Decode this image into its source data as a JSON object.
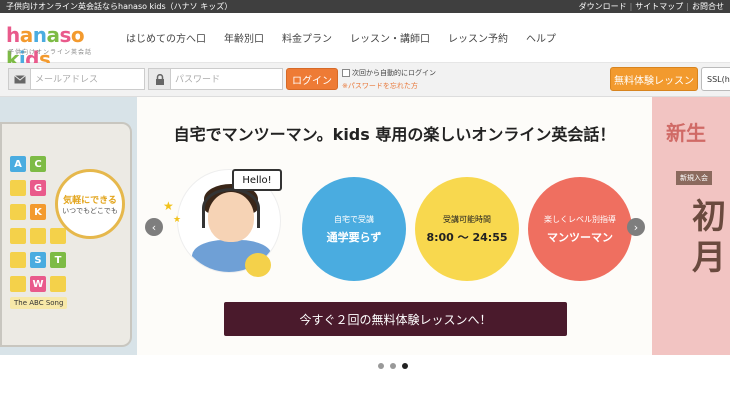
{
  "topbar": {
    "tagline": "子供向けオンライン英会話ならhanaso kids（ハナソ キッズ）",
    "links": [
      "ダウンロード",
      "サイトマップ",
      "お問合せ"
    ]
  },
  "logo": {
    "word": "hanaso kids",
    "sub": "子供向けオンライン英会話"
  },
  "nav": [
    "はじめての方へ口",
    "年齢別口",
    "料金プラン",
    "レッスン・講師口",
    "レッスン予約",
    "ヘルプ"
  ],
  "login": {
    "email_placeholder": "メールアドレス",
    "password_placeholder": "パスワード",
    "login_label": "ログイン",
    "autologin_label": "次回から自動的にログイン",
    "forgot_label": "※パスワードを忘れた方",
    "trial_label": "無料体験レッスン",
    "ssl_label": "SSL(ht"
  },
  "hero": {
    "headline": "自宅でマンツーマン。kids 専用の楽しいオンライン英会話！",
    "hello": "Hello!",
    "features": [
      {
        "top": "自宅で受講",
        "main": "通学要らず"
      },
      {
        "top": "受講可能時間",
        "main": "8:00 〜 24:55"
      },
      {
        "top": "楽しくレベル別指導",
        "main": "マンツーマン"
      }
    ],
    "cta": "今すぐ２回の無料体験レッスンへ！"
  },
  "left_slide": {
    "bubble_main": "気軽にできる",
    "bubble_sub": "いつでもどこでも",
    "tiles": [
      "A",
      "C",
      "G",
      "K",
      "S",
      "T",
      "W"
    ],
    "song": "The ABC Song"
  },
  "right_slide": {
    "title": "新生",
    "sub": "新規入会",
    "big": "初月"
  },
  "arrows": {
    "left": "‹",
    "right": "›"
  },
  "colors": {
    "accent_orange": "#ee7b35",
    "blue": "#4aace0",
    "yellow": "#f8d84e",
    "red": "#ef6f60",
    "cta": "#4a1a2c"
  }
}
